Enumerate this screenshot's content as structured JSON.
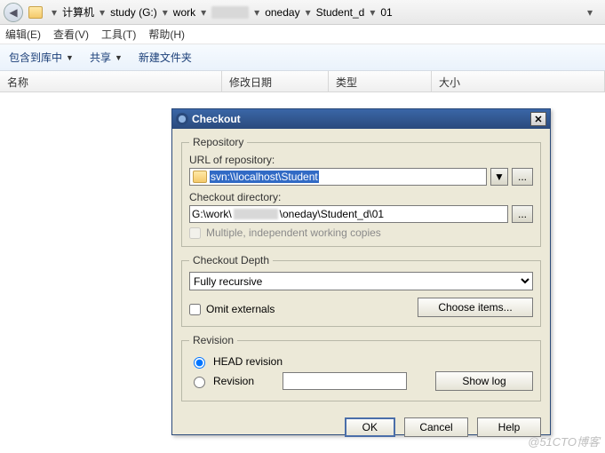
{
  "breadcrumb": {
    "segments": [
      "计算机",
      "study (G:)",
      "work",
      "",
      "oneday",
      "Student_d",
      "01"
    ]
  },
  "menubar": {
    "edit": "编辑(E)",
    "view": "查看(V)",
    "tools": "工具(T)",
    "help": "帮助(H)"
  },
  "toolbar": {
    "include": "包含到库中",
    "share": "共享",
    "newfolder": "新建文件夹"
  },
  "columns": {
    "name": "名称",
    "date": "修改日期",
    "type": "类型",
    "size": "大小"
  },
  "dialog": {
    "title": "Checkout",
    "repo_legend": "Repository",
    "url_label": "URL of repository:",
    "url_value": "svn:\\\\localhost\\Student",
    "dir_label": "Checkout directory:",
    "dir_prefix": "G:\\work\\",
    "dir_suffix": "\\oneday\\Student_d\\01",
    "multi_label": "Multiple, independent working copies",
    "depth_legend": "Checkout Depth",
    "depth_value": "Fully recursive",
    "omit_label": "Omit externals",
    "choose_items": "Choose items...",
    "rev_legend": "Revision",
    "head_label": "HEAD revision",
    "rev_label": "Revision",
    "showlog": "Show log",
    "ok": "OK",
    "cancel": "Cancel",
    "help": "Help"
  },
  "watermark": "@51CTO博客"
}
